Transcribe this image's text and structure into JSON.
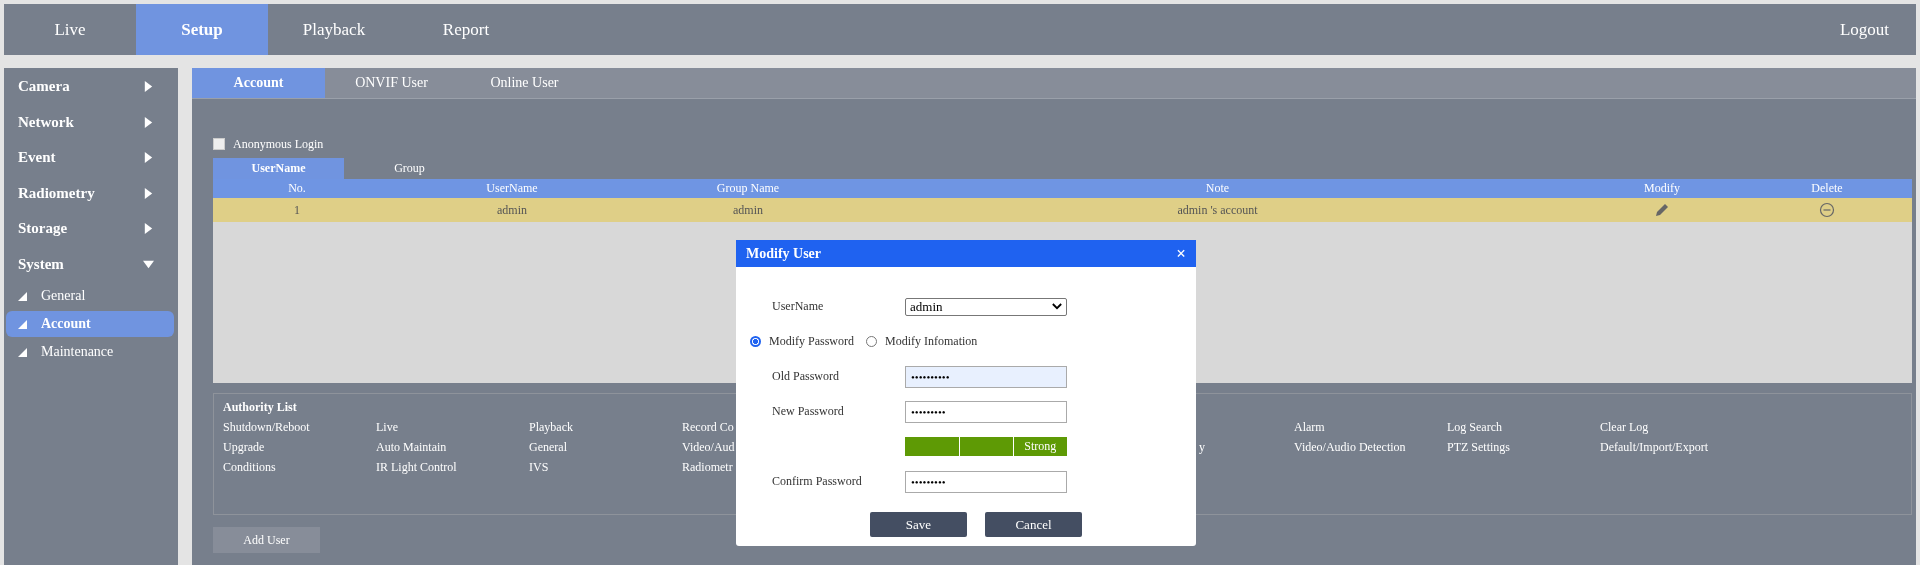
{
  "nav": {
    "items": [
      {
        "label": "Live",
        "selected": false
      },
      {
        "label": "Setup",
        "selected": true
      },
      {
        "label": "Playback",
        "selected": false
      },
      {
        "label": "Report",
        "selected": false
      }
    ],
    "logout": "Logout"
  },
  "sidebar": {
    "items": [
      {
        "label": "Camera",
        "expanded": false
      },
      {
        "label": "Network",
        "expanded": false
      },
      {
        "label": "Event",
        "expanded": false
      },
      {
        "label": "Radiometry",
        "expanded": false
      },
      {
        "label": "Storage",
        "expanded": false
      },
      {
        "label": "System",
        "expanded": true,
        "children": [
          {
            "label": "General",
            "selected": false
          },
          {
            "label": "Account",
            "selected": true
          },
          {
            "label": "Maintenance",
            "selected": false
          }
        ]
      }
    ]
  },
  "subtabs": [
    {
      "label": "Account",
      "selected": true
    },
    {
      "label": "ONVIF User",
      "selected": false
    },
    {
      "label": "Online User",
      "selected": false
    }
  ],
  "anonymous_login": {
    "label": "Anonymous Login",
    "checked": false
  },
  "inner_tabs": [
    {
      "label": "UserName",
      "selected": true
    },
    {
      "label": "Group",
      "selected": false
    }
  ],
  "table": {
    "columns": [
      "No.",
      "UserName",
      "Group Name",
      "Note",
      "Modify",
      "Delete"
    ],
    "rows": [
      {
        "no": "1",
        "username": "admin",
        "group_name": "admin",
        "note": "admin 's account",
        "selected": true
      }
    ]
  },
  "authority_list": {
    "title": "Authority List",
    "rows": [
      [
        "Shutdown/Reboot",
        "Live",
        "Playback",
        "Record Co",
        null,
        null,
        null,
        "Alarm",
        "Log Search",
        "Clear Log"
      ],
      [
        "Upgrade",
        "Auto Maintain",
        "General",
        "Video/Aud",
        null,
        null,
        "y",
        "Video/Audio Detection",
        "PTZ Settings",
        "Default/Import/Export"
      ],
      [
        "Conditions",
        "IR Light Control",
        "IVS",
        "Radiometr",
        null,
        null,
        null,
        null,
        null,
        null
      ]
    ]
  },
  "add_user_button": "Add User",
  "dialog": {
    "title": "Modify User",
    "close": "×",
    "username": {
      "label": "UserName",
      "value": "admin"
    },
    "modes": [
      {
        "label": "Modify Password",
        "selected": true
      },
      {
        "label": "Modify Infomation",
        "selected": false
      }
    ],
    "old_password": {
      "label": "Old Password",
      "value": "••••••••••",
      "focused": true
    },
    "new_password": {
      "label": "New Password",
      "value": "•••••••••"
    },
    "strength": {
      "label": "Strong",
      "level": 1
    },
    "confirm_password": {
      "label": "Confirm Password",
      "value": "•••••••••"
    },
    "buttons": [
      "Save",
      "Cancel"
    ]
  }
}
